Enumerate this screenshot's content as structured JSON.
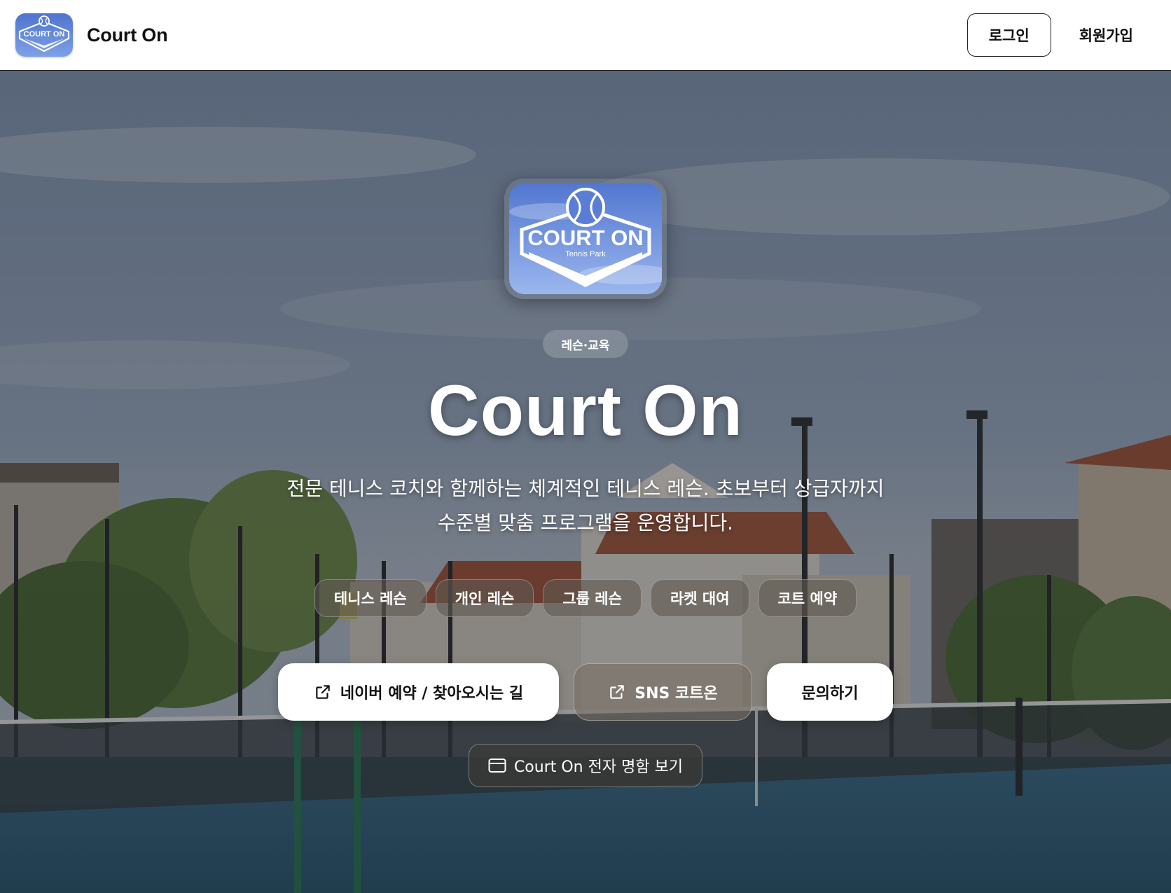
{
  "header": {
    "brand_name": "Court On",
    "login_label": "로그인",
    "signup_label": "회원가입"
  },
  "logo": {
    "title": "COURT ON",
    "subtitle": "Tennis Park"
  },
  "hero": {
    "category": "레슨·교육",
    "title": "Court On",
    "description_line1": "전문 테니스 코치와 함께하는 체계적인 테니스 레슨. 초보부터 상급자까지",
    "description_line2": "수준별 맞춤 프로그램을 운영합니다.",
    "tags": [
      "테니스 레슨",
      "개인 레슨",
      "그룹 레슨",
      "라켓 대여",
      "코트 예약"
    ],
    "actions": {
      "naver_label": "네이버 예약 / 찾아오시는 길",
      "sns_label": "SNS 코트온",
      "inquiry_label": "문의하기"
    },
    "card_label": "Court On 전자 명함 보기"
  },
  "colors": {
    "logo_blue": "#5a7ed6",
    "header_bg": "#ffffff",
    "text_dark": "#111111"
  },
  "icons": {
    "external_link": "external-link-icon",
    "card": "card-icon"
  }
}
